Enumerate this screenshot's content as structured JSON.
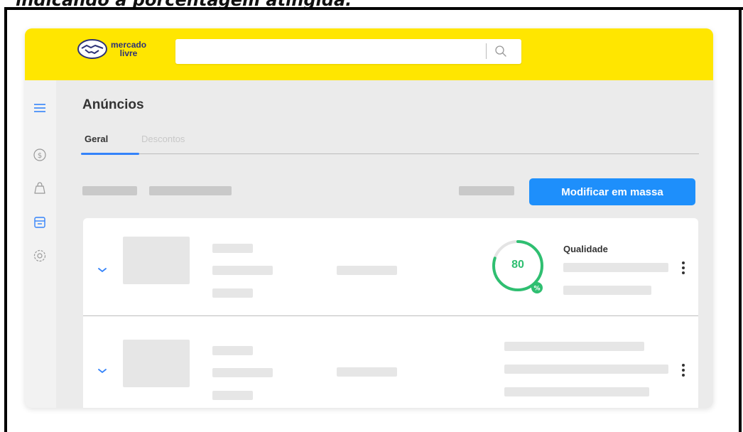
{
  "caption": "indicando a porcentagem atingida.",
  "header": {
    "logo_line1": "mercado",
    "logo_line2": "livre",
    "search_placeholder": ""
  },
  "sidebar": {
    "icons": [
      "menu-icon",
      "dollar-icon",
      "bag-icon",
      "store-icon",
      "settings-icon"
    ]
  },
  "main": {
    "title": "Anúncios",
    "tabs": [
      {
        "label": "Geral",
        "active": true
      },
      {
        "label": "Descontos",
        "active": false
      }
    ],
    "mass_button": "Modificar em massa",
    "listings": [
      {
        "quality_label": "Qualidade",
        "quality_score": "80",
        "quality_percent": 80,
        "badge_text": "%"
      },
      {}
    ]
  },
  "colors": {
    "header": "#ffe600",
    "accent": "#3483fa",
    "button": "#1e8ffb",
    "quality_green": "#2fbf71"
  }
}
